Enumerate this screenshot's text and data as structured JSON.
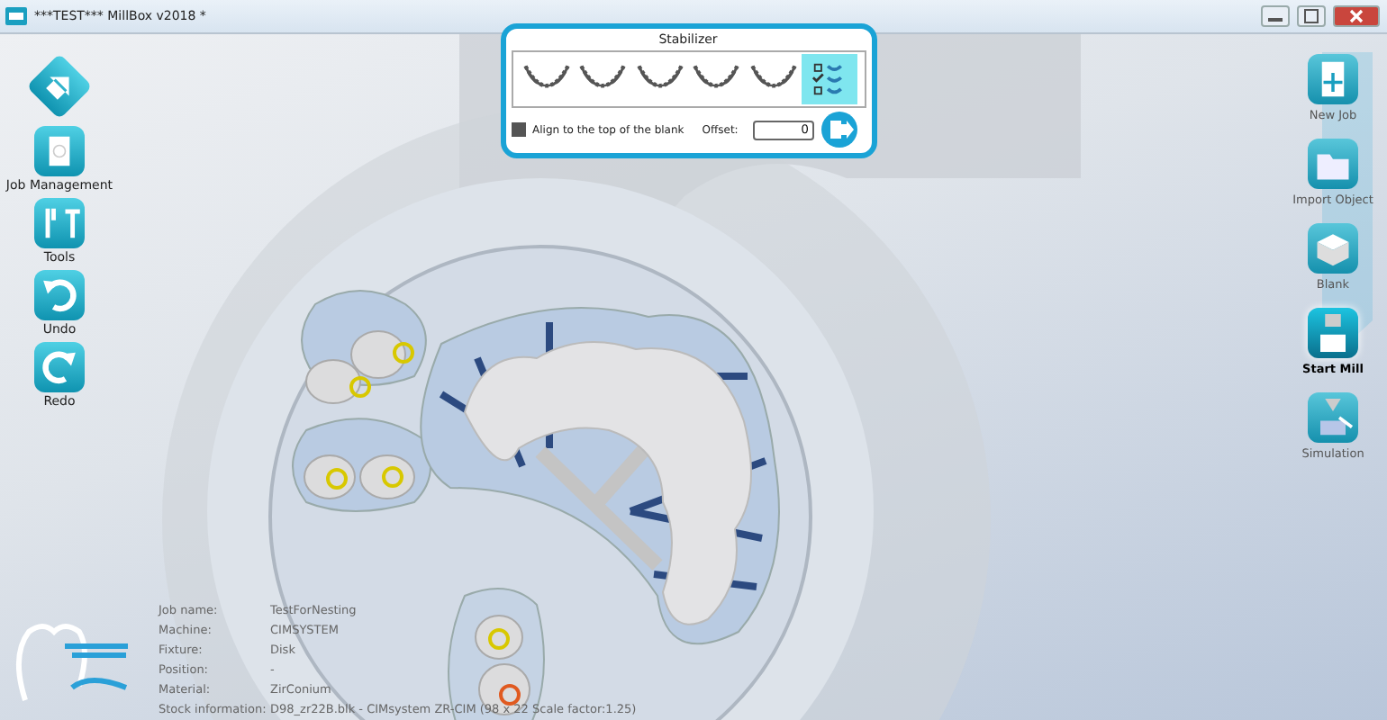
{
  "window": {
    "title": "***TEST*** MillBox v2018 *"
  },
  "left_toolbar": [
    {
      "label": "Job Management"
    },
    {
      "label": "Tools"
    },
    {
      "label": "Undo"
    },
    {
      "label": "Redo"
    }
  ],
  "stabilizer": {
    "title": "Stabilizer",
    "options": [
      {
        "selected": false
      },
      {
        "selected": false
      },
      {
        "selected": false
      },
      {
        "selected": false
      },
      {
        "selected": false
      },
      {
        "selected": true
      }
    ],
    "align_top": {
      "label": "Align to the top of the blank",
      "checked": true
    },
    "offset": {
      "label": "Offset:",
      "value": "0"
    }
  },
  "right_toolbar": [
    {
      "label": "New Job",
      "selected": false
    },
    {
      "label": "Import Object",
      "selected": false
    },
    {
      "label": "Blank",
      "selected": false
    },
    {
      "label": "Start Mill",
      "selected": true
    },
    {
      "label": "Simulation",
      "selected": false
    }
  ],
  "job_info": [
    {
      "label": "Job name:",
      "value": "TestForNesting"
    },
    {
      "label": "Machine:",
      "value": "CIMSYSTEM"
    },
    {
      "label": "Fixture:",
      "value": "Disk"
    },
    {
      "label": "Position:",
      "value": "-"
    },
    {
      "label": "Material:",
      "value": "ZirConium"
    },
    {
      "label": "Stock information:",
      "value": "D98_zr22B.blk - CIMsystem ZR-CIM (98 x 22 Scale factor:1.25)"
    }
  ]
}
